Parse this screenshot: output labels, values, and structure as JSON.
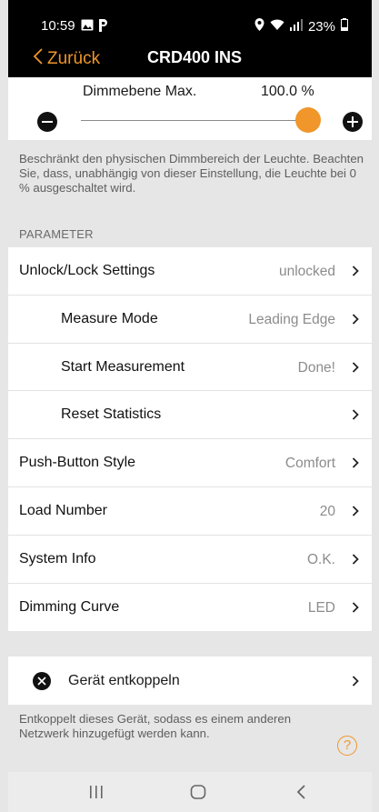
{
  "status_bar": {
    "time": "10:59",
    "battery": "23%",
    "icons": [
      "gallery-icon",
      "parking-icon",
      "location-icon",
      "wifi-icon",
      "signal-icon",
      "battery-icon"
    ]
  },
  "nav": {
    "back_label": "Zurück",
    "title": "CRD400 INS"
  },
  "dimming": {
    "label": "Dimmebene Max.",
    "value": "100.0 %",
    "slider_level": 1.0,
    "description": "Beschränkt den physischen Dimmbereich der Leuchte. Beachten Sie, dass, unabhängig von dieser Einstellung, die Leuchte bei 0 % ausgeschaltet wird."
  },
  "parameters": {
    "header": "PARAMETER",
    "items": [
      {
        "label": "Unlock/Lock Settings",
        "value": "unlocked",
        "indent": false
      },
      {
        "label": "Measure Mode",
        "value": "Leading Edge",
        "indent": true
      },
      {
        "label": "Start Measurement",
        "value": "Done!",
        "indent": true
      },
      {
        "label": "Reset Statistics",
        "value": "",
        "indent": true
      },
      {
        "label": "Push-Button Style",
        "value": "Comfort",
        "indent": false
      },
      {
        "label": "Load Number",
        "value": "20",
        "indent": false
      },
      {
        "label": "System Info",
        "value": "O.K.",
        "indent": false
      },
      {
        "label": "Dimming Curve",
        "value": "LED",
        "indent": false
      }
    ]
  },
  "decouple": {
    "label": "Gerät entkoppeln",
    "description": "Entkoppelt dieses Gerät, sodass es einem anderen Netzwerk hinzugefügt werden kann.",
    "help_symbol": "?"
  },
  "colors": {
    "accent": "#f0962a",
    "topbar": "#000000",
    "background": "#e6e6e6"
  }
}
